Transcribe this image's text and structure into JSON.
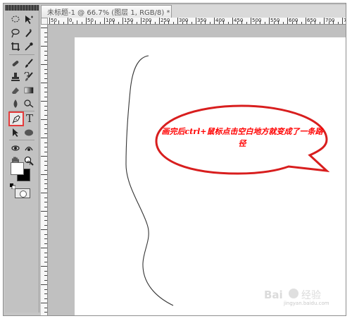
{
  "document": {
    "tab_title": "未标题-1 @ 66.7% (图层 1, RGB/8) *",
    "ruler_labels": [
      "50",
      "0",
      "50",
      "100",
      "150",
      "200",
      "250",
      "300",
      "350",
      "400",
      "450",
      "500",
      "550",
      "600",
      "650",
      "700",
      "750"
    ]
  },
  "toolbar": {
    "tools": [
      {
        "name": "lasso",
        "icon": "lasso-icon"
      },
      {
        "name": "move",
        "icon": "move-icon"
      },
      {
        "name": "quick-selection",
        "icon": "quick-selection-icon"
      },
      {
        "name": "magic-wand",
        "icon": "magic-wand-icon"
      },
      {
        "name": "crop",
        "icon": "crop-icon"
      },
      {
        "name": "eyedropper",
        "icon": "eyedropper-icon"
      },
      {
        "name": "healing-brush",
        "icon": "healing-brush-icon"
      },
      {
        "name": "brush",
        "icon": "brush-icon"
      },
      {
        "name": "clone-stamp",
        "icon": "clone-stamp-icon"
      },
      {
        "name": "history-brush",
        "icon": "history-brush-icon"
      },
      {
        "name": "eraser",
        "icon": "eraser-icon"
      },
      {
        "name": "gradient",
        "icon": "gradient-icon"
      },
      {
        "name": "blur",
        "icon": "blur-icon"
      },
      {
        "name": "dodge",
        "icon": "dodge-icon"
      },
      {
        "name": "pen",
        "icon": "pen-icon",
        "highlighted": true
      },
      {
        "name": "type",
        "icon": "type-icon",
        "label": "T"
      },
      {
        "name": "path-selection",
        "icon": "path-selection-icon"
      },
      {
        "name": "shape",
        "icon": "ellipse-icon"
      },
      {
        "name": "3d-rotate",
        "icon": "3d-rotate-icon"
      },
      {
        "name": "3d-orbit",
        "icon": "3d-orbit-icon"
      },
      {
        "name": "hand",
        "icon": "hand-icon"
      },
      {
        "name": "zoom",
        "icon": "zoom-icon"
      }
    ],
    "foreground_color": "#ffffff",
    "background_color": "#000000",
    "highlight_color": "#e43b3b"
  },
  "annotation": {
    "text": "画完后ctrl+鼠标点击空白地方就变成了一条路径",
    "text_color": "#ff0000",
    "bubble_stroke": "#d81e1e"
  },
  "watermark": {
    "brand": "Bai 经验",
    "url": "jingyan.baidu.com"
  }
}
